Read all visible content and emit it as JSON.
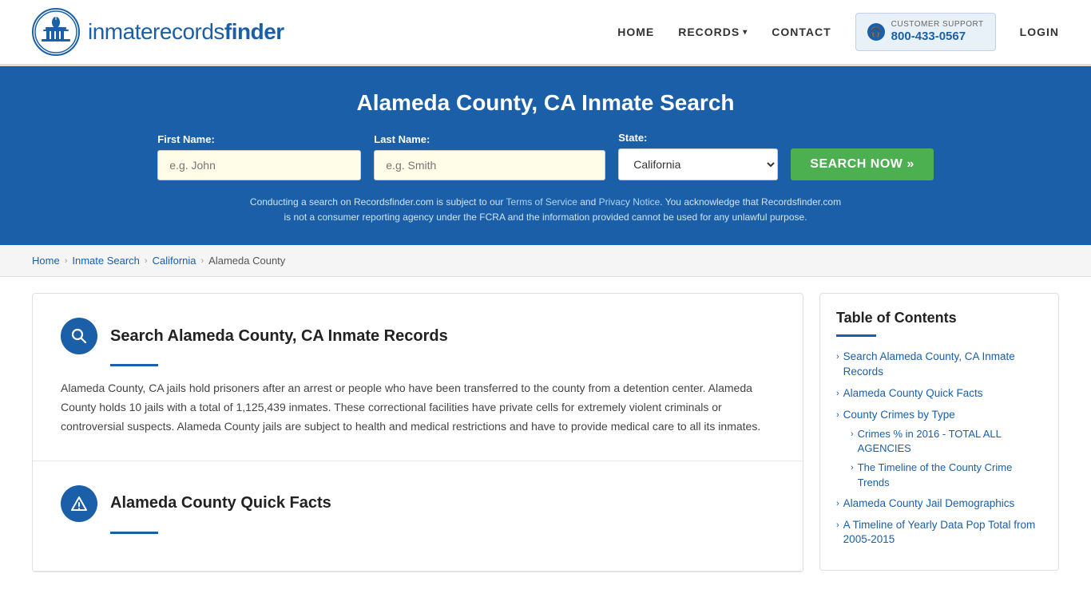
{
  "header": {
    "logo_text_regular": "inmaterecords",
    "logo_text_bold": "finder",
    "nav": {
      "home": "HOME",
      "records": "RECORDS",
      "contact": "CONTACT",
      "login": "LOGIN"
    },
    "support": {
      "label": "CUSTOMER SUPPORT",
      "number": "800-433-0567"
    }
  },
  "hero": {
    "title": "Alameda County, CA Inmate Search",
    "form": {
      "first_name_label": "First Name:",
      "first_name_placeholder": "e.g. John",
      "last_name_label": "Last Name:",
      "last_name_placeholder": "e.g. Smith",
      "state_label": "State:",
      "state_value": "California",
      "search_button": "SEARCH NOW »"
    },
    "disclaimer": "Conducting a search on Recordsfinder.com is subject to our Terms of Service and Privacy Notice. You acknowledge that Recordsfinder.com is not a consumer reporting agency under the FCRA and the information provided cannot be used for any unlawful purpose."
  },
  "breadcrumb": {
    "home": "Home",
    "inmate_search": "Inmate Search",
    "state": "California",
    "county": "Alameda County"
  },
  "main": {
    "section1": {
      "title": "Search Alameda County, CA Inmate Records",
      "body": "Alameda County, CA jails hold prisoners after an arrest or people who have been transferred to the county from a detention center. Alameda County holds 10 jails with a total of 1,125,439 inmates. These correctional facilities have private cells for extremely violent criminals or controversial suspects. Alameda County jails are subject to health and medical restrictions and have to provide medical care to all its inmates."
    },
    "section2": {
      "title": "Alameda County Quick Facts"
    }
  },
  "toc": {
    "title": "Table of Contents",
    "items": [
      {
        "label": "Search Alameda County, CA Inmate Records",
        "sub": []
      },
      {
        "label": "Alameda County Quick Facts",
        "sub": []
      },
      {
        "label": "County Crimes by Type",
        "sub": [
          {
            "label": "Crimes % in 2016 - TOTAL ALL AGENCIES"
          },
          {
            "label": "The Timeline of the County Crime Trends"
          }
        ]
      },
      {
        "label": "Alameda County Jail Demographics",
        "sub": []
      },
      {
        "label": "A Timeline of Yearly Data Pop Total from 2005-2015",
        "sub": []
      }
    ]
  }
}
